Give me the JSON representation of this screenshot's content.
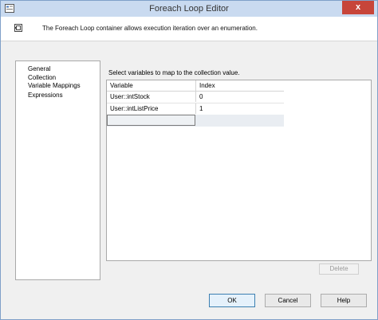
{
  "window": {
    "title": "Foreach Loop Editor",
    "close_glyph": "x"
  },
  "header": {
    "description": "The Foreach Loop container allows execution iteration over an enumeration.",
    "icon": "foreach-loop-icon"
  },
  "nav": {
    "items": [
      {
        "label": "General"
      },
      {
        "label": "Collection"
      },
      {
        "label": "Variable Mappings"
      },
      {
        "label": "Expressions"
      }
    ]
  },
  "content": {
    "instruction": "Select variables to map to the collection value.",
    "grid": {
      "columns": [
        "Variable",
        "Index"
      ],
      "rows": [
        {
          "variable": "User::intStock",
          "index": "0"
        },
        {
          "variable": "User::intListPrice",
          "index": "1"
        }
      ]
    },
    "delete_label": "Delete"
  },
  "footer": {
    "ok_label": "OK",
    "cancel_label": "Cancel",
    "help_label": "Help"
  },
  "colors": {
    "titlebar": "#c9daf0",
    "close_button": "#c7453a",
    "ok_border": "#3c7fb1"
  }
}
